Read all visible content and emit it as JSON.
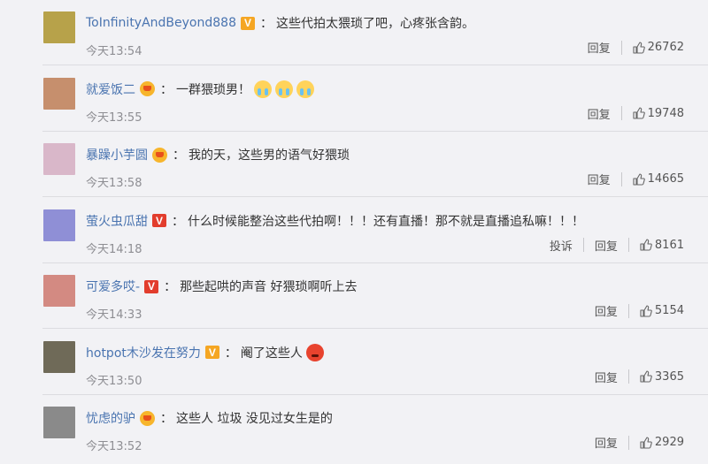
{
  "comments": [
    {
      "username": "ToInfinityAndBeyond888",
      "badge": "v",
      "text": "这些代拍太猥琐了吧，心疼张含韵。",
      "emojis": [],
      "time": "今天13:54",
      "report": "",
      "reply": "回复",
      "likes": "26762",
      "avatar_color": "#b7a24a"
    },
    {
      "username": "就爱饭二",
      "badge": "crown",
      "text": "一群猥琐男！",
      "emojis": [
        "cry-emoji",
        "cry-emoji",
        "cry-emoji"
      ],
      "time": "今天13:55",
      "report": "",
      "reply": "回复",
      "likes": "19748",
      "avatar_color": "#c68f6d"
    },
    {
      "username": "暴躁小芋圆",
      "badge": "crown",
      "text": "我的天，这些男的语气好猥琐",
      "emojis": [],
      "time": "今天13:58",
      "report": "",
      "reply": "回复",
      "likes": "14665",
      "avatar_color": "#d9b7c9"
    },
    {
      "username": "萤火虫瓜甜",
      "badge": "v-red",
      "text": "什么时候能整治这些代拍啊！！！还有直播！那不就是直播追私嘛！！！",
      "emojis": [],
      "time": "今天14:18",
      "report": "投诉",
      "reply": "回复",
      "likes": "8161",
      "avatar_color": "#8f8fd6"
    },
    {
      "username": "可爱多哎-",
      "badge": "v-red",
      "text": "那些起哄的声音 好猥琐啊听上去",
      "emojis": [],
      "time": "今天14:33",
      "report": "",
      "reply": "回复",
      "likes": "5154",
      "avatar_color": "#d38a82"
    },
    {
      "username": "hotpot木沙发在努力",
      "badge": "v",
      "text": "阉了这些人",
      "emojis": [
        "angry-emoji"
      ],
      "time": "今天13:50",
      "report": "",
      "reply": "回复",
      "likes": "3365",
      "avatar_color": "#6f6a58"
    },
    {
      "username": "忧虑的驴",
      "badge": "crown",
      "text": "这些人 垃圾 没见过女生是的",
      "emojis": [],
      "time": "今天13:52",
      "report": "",
      "reply": "回复",
      "likes": "2929",
      "avatar_color": "#8a8a8a"
    }
  ]
}
